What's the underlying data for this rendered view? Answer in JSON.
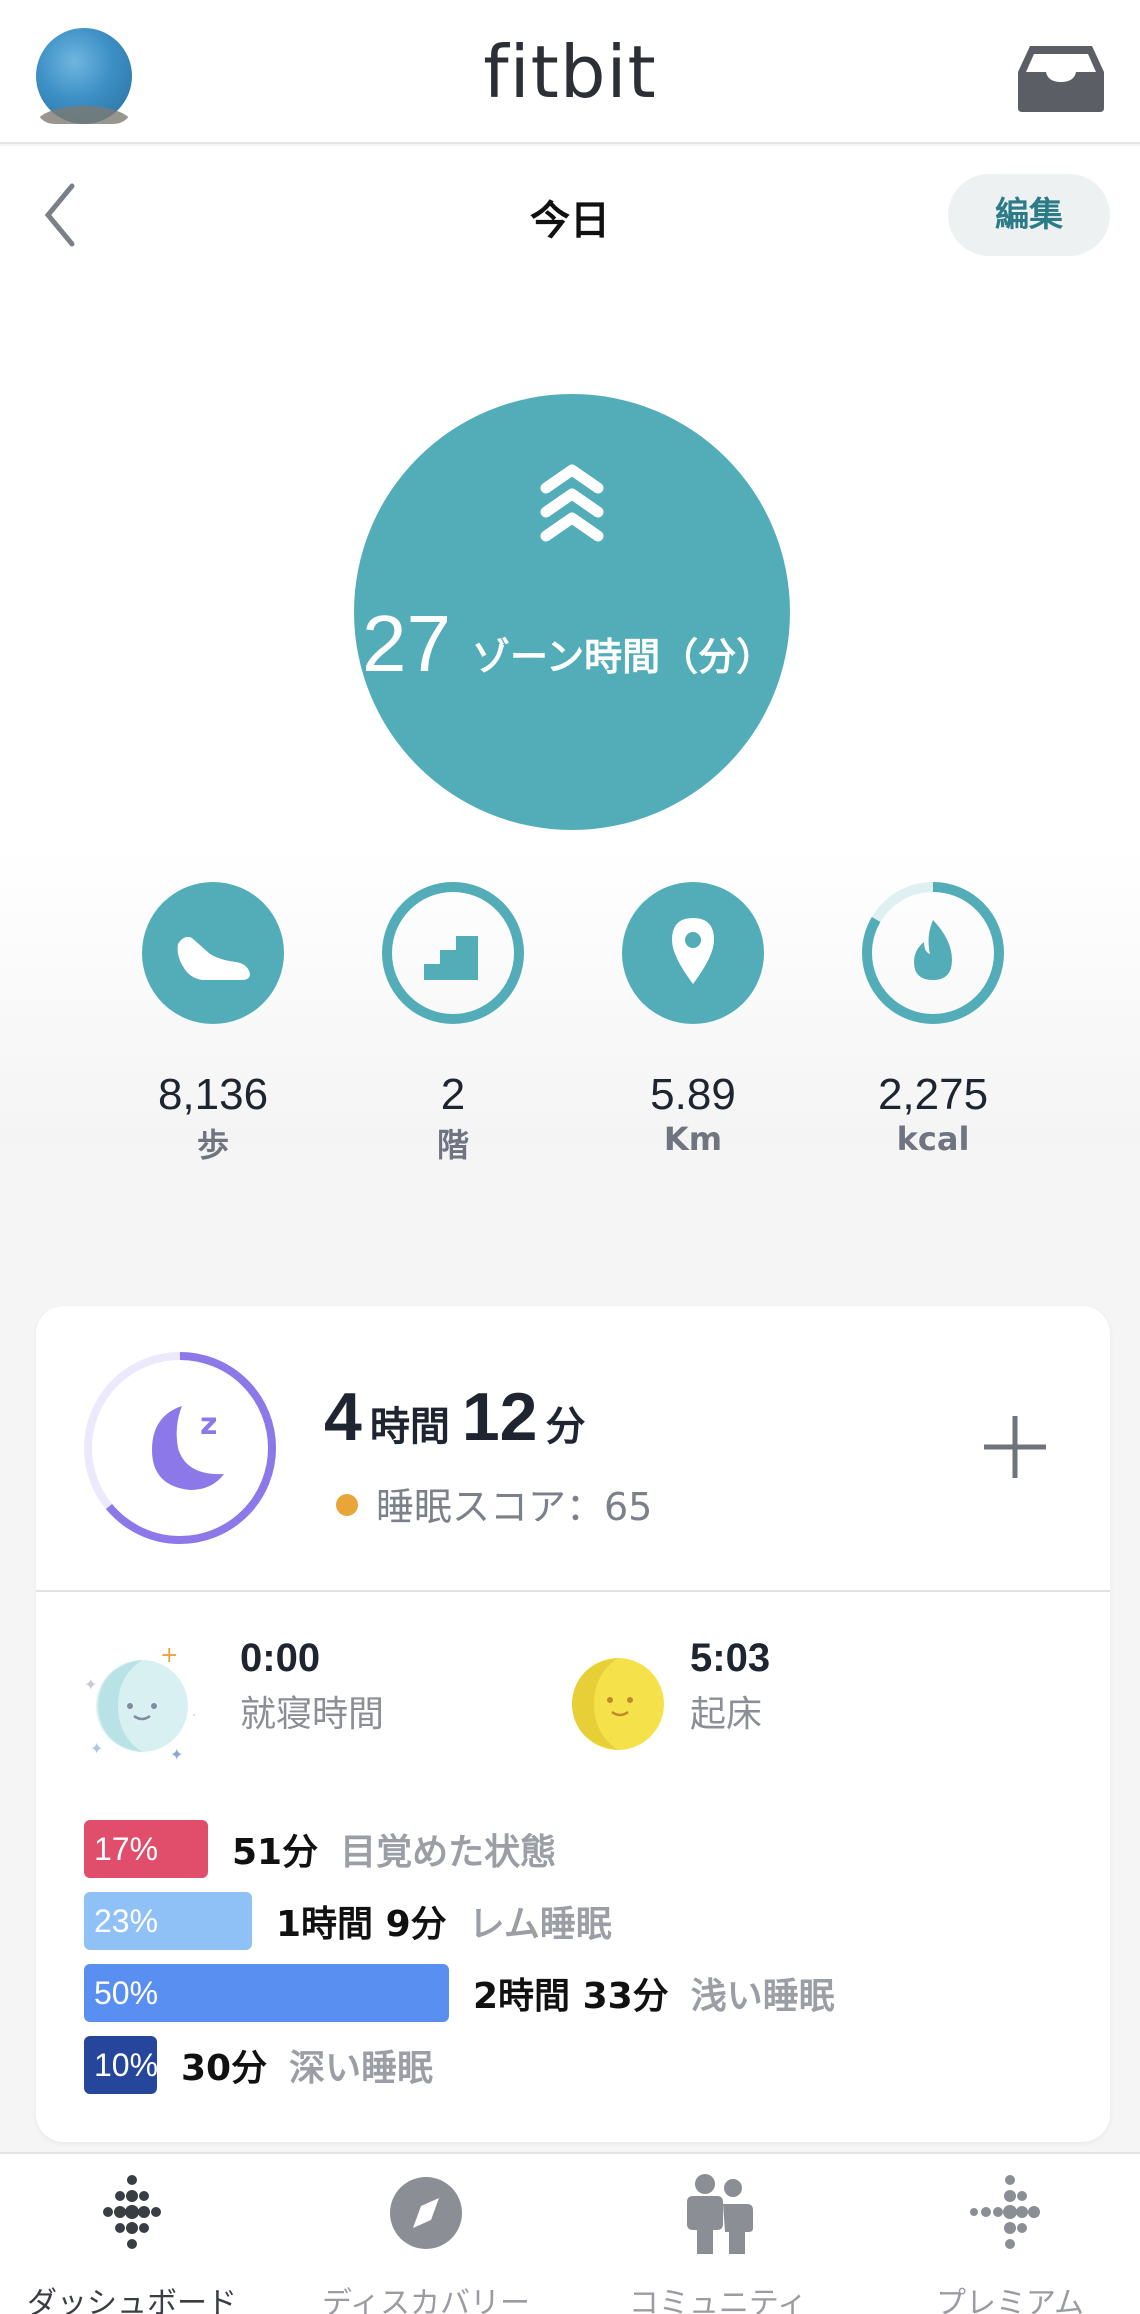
{
  "header": {
    "brand": "fitbit"
  },
  "page": {
    "title": "今日",
    "edit_label": "編集"
  },
  "zone": {
    "value": "27",
    "label": "ゾーン時間（分）",
    "color": "#52adb8"
  },
  "stats": [
    {
      "icon": "shoe-icon",
      "value": "8,136",
      "unit": "歩"
    },
    {
      "icon": "stairs-icon",
      "value": "2",
      "unit": "階"
    },
    {
      "icon": "location-pin-icon",
      "value": "5.89",
      "unit": "Km"
    },
    {
      "icon": "flame-icon",
      "value": "2,275",
      "unit": "kcal"
    }
  ],
  "sleep": {
    "hours": "4",
    "hours_unit": "時間",
    "minutes": "12",
    "minutes_unit": "分",
    "score_label": "睡眠スコア：65",
    "bedtime": {
      "time": "0:00",
      "label": "就寝時間"
    },
    "wake": {
      "time": "5:03",
      "label": "起床"
    },
    "stages": [
      {
        "percent": "17%",
        "percent_value": 17,
        "duration": "51分",
        "name": "目覚めた状態",
        "color": "#e04e6c"
      },
      {
        "percent": "23%",
        "percent_value": 23,
        "duration": "1時間 9分",
        "name": "レム睡眠",
        "color": "#8fc1f7"
      },
      {
        "percent": "50%",
        "percent_value": 50,
        "duration": "2時間 33分",
        "name": "浅い睡眠",
        "color": "#5a8ff2"
      },
      {
        "percent": "10%",
        "percent_value": 10,
        "duration": "30分",
        "name": "深い睡眠",
        "color": "#26469c"
      }
    ]
  },
  "nav": [
    {
      "icon": "dashboard-dots-icon",
      "label": "ダッシュボード",
      "active": true
    },
    {
      "icon": "compass-icon",
      "label": "ディスカバリー",
      "active": false
    },
    {
      "icon": "community-icon",
      "label": "コミュニティ",
      "active": false
    },
    {
      "icon": "premium-dots-icon",
      "label": "プレミアム",
      "active": false
    }
  ]
}
